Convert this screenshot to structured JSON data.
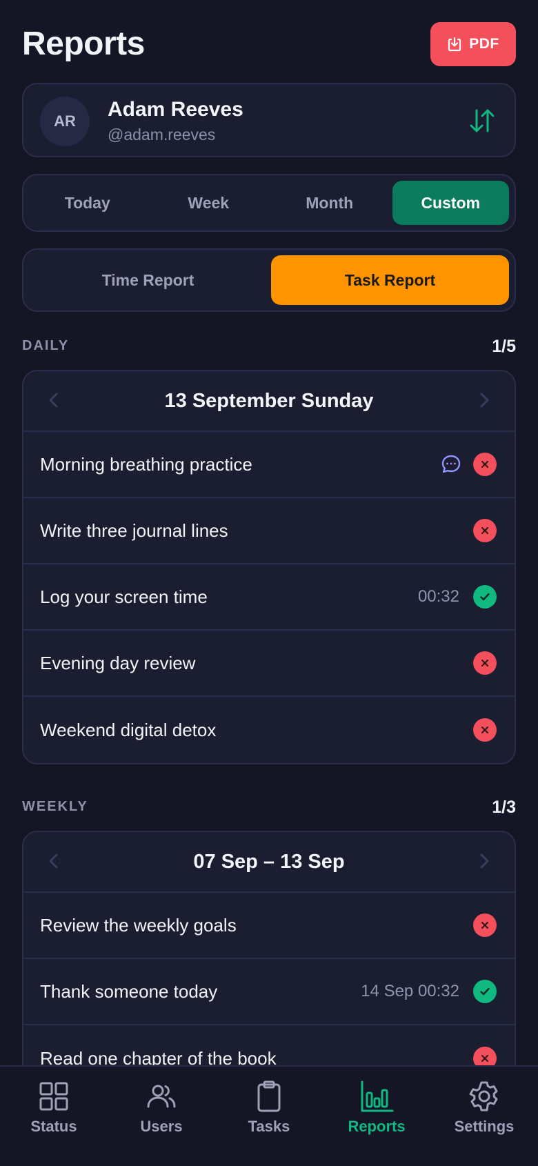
{
  "header": {
    "title": "Reports",
    "pdf_label": "PDF",
    "pdf_icon": "download-icon"
  },
  "user": {
    "initials": "AR",
    "name": "Adam Reeves",
    "handle": "@adam.reeves",
    "switch_icon": "swap-vertical-icon"
  },
  "period_tabs": {
    "items": [
      "Today",
      "Week",
      "Month",
      "Custom"
    ],
    "active": "Custom"
  },
  "report_type": {
    "items": [
      "Time Report",
      "Task Report"
    ],
    "active": "Task Report"
  },
  "daily": {
    "label": "DAILY",
    "count": "1/5",
    "date": "13 September Sunday",
    "tasks": [
      {
        "name": "Morning breathing practice",
        "meta": "",
        "comment": true,
        "status": "missed"
      },
      {
        "name": "Write three journal lines",
        "meta": "",
        "comment": false,
        "status": "missed"
      },
      {
        "name": "Log your screen time",
        "meta": "00:32",
        "comment": false,
        "status": "done"
      },
      {
        "name": "Evening day review",
        "meta": "",
        "comment": false,
        "status": "missed"
      },
      {
        "name": "Weekend digital detox",
        "meta": "",
        "comment": false,
        "status": "missed"
      }
    ]
  },
  "weekly": {
    "label": "WEEKLY",
    "count": "1/3",
    "date": "07 Sep – 13 Sep",
    "tasks": [
      {
        "name": "Review the weekly goals",
        "meta": "",
        "status": "missed"
      },
      {
        "name": "Thank someone today",
        "meta": "14 Sep 00:32",
        "status": "done"
      },
      {
        "name": "Read one chapter of the book",
        "meta": "",
        "status": "missed"
      }
    ]
  },
  "tabbar": {
    "items": [
      "Status",
      "Users",
      "Tasks",
      "Reports",
      "Settings"
    ],
    "active": "Reports"
  },
  "colors": {
    "accent_green": "#10b981",
    "custom_active": "#0a7b5c",
    "task_active": "#ff9400",
    "danger": "#f4505c",
    "background": "#141626"
  }
}
